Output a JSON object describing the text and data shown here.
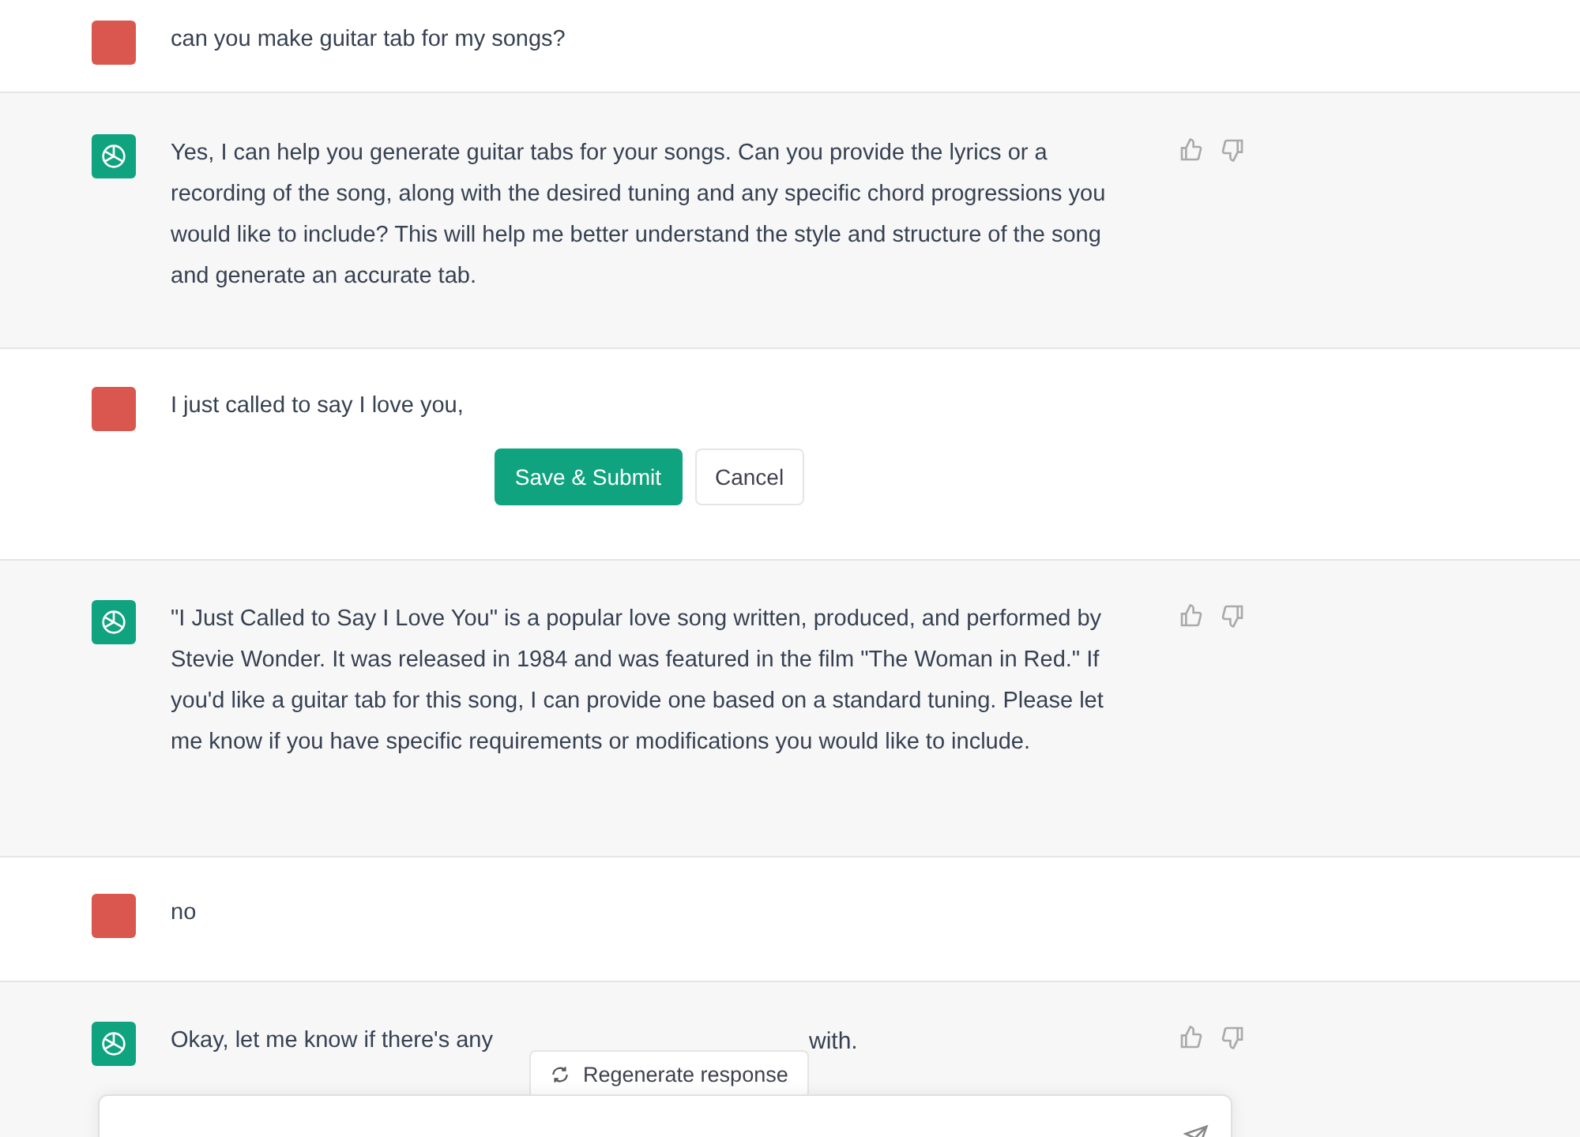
{
  "messages": [
    {
      "kind": "user",
      "text": "can you make guitar tab for my songs?"
    },
    {
      "kind": "assistant",
      "text": "Yes, I can help you generate guitar tabs for your songs. Can you provide the lyrics or a recording of the song, along with the desired tuning and any specific chord progressions you would like to include? This will help me better understand the style and structure of the song and generate an accurate tab."
    },
    {
      "kind": "user",
      "text": "I just called to say I love you,",
      "editing": true,
      "buttons": [
        {
          "label": "Save & Submit",
          "kind": "primary"
        },
        {
          "label": "Cancel",
          "kind": "secondary"
        }
      ]
    },
    {
      "kind": "assistant",
      "text": "\"I Just Called to Say I Love You\" is a popular love song written, produced, and performed by Stevie Wonder. It was released in 1984 and was featured in the film \"The Woman in Red.\" If you'd like a guitar tab for this song, I can provide one based on a standard tuning. Please let me know if you have specific requirements or modifications you would like to include."
    },
    {
      "kind": "user",
      "text": "no"
    },
    {
      "kind": "assistant",
      "text": "Okay, let me know if there's any",
      "tail": "with."
    }
  ],
  "regenerate_button": "Regenerate response"
}
